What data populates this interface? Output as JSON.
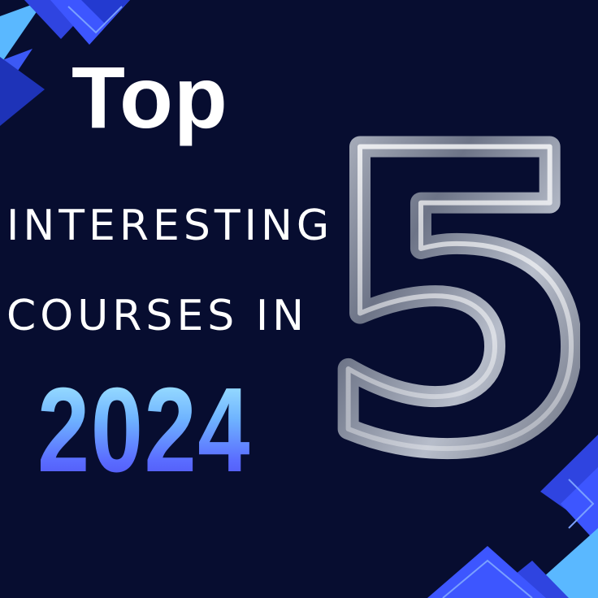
{
  "headline": {
    "top": "Top",
    "line1": "INTERESTING",
    "line2": "COURSES IN",
    "year": "2024"
  },
  "feature_number": "5",
  "colors": {
    "background": "#070d30",
    "text": "#ffffff",
    "accent_blue": "#2f44e0",
    "accent_light": "#5ab8ff",
    "number_chrome": "#8f97aa"
  }
}
